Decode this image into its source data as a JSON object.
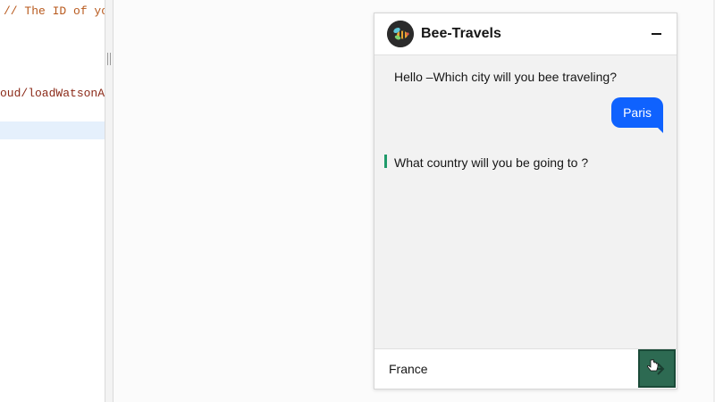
{
  "editor": {
    "line1": "// The ID of yo",
    "line2": "oud/loadWatsonA"
  },
  "chat": {
    "title": "Bee-Travels",
    "avatar_icon": "bee-logo-icon",
    "messages": [
      {
        "from": "bot",
        "text": "Hello –Which city will you bee traveling?"
      },
      {
        "from": "user",
        "text": "Paris"
      },
      {
        "from": "bot",
        "text": "What country will you be going to ?"
      }
    ],
    "input": {
      "value": "France"
    },
    "send_icon": "arrow-right-icon",
    "colors": {
      "user_bubble": "#0f62fe",
      "accent": "#1f9a6a",
      "send_button": "#2d6a52"
    }
  }
}
